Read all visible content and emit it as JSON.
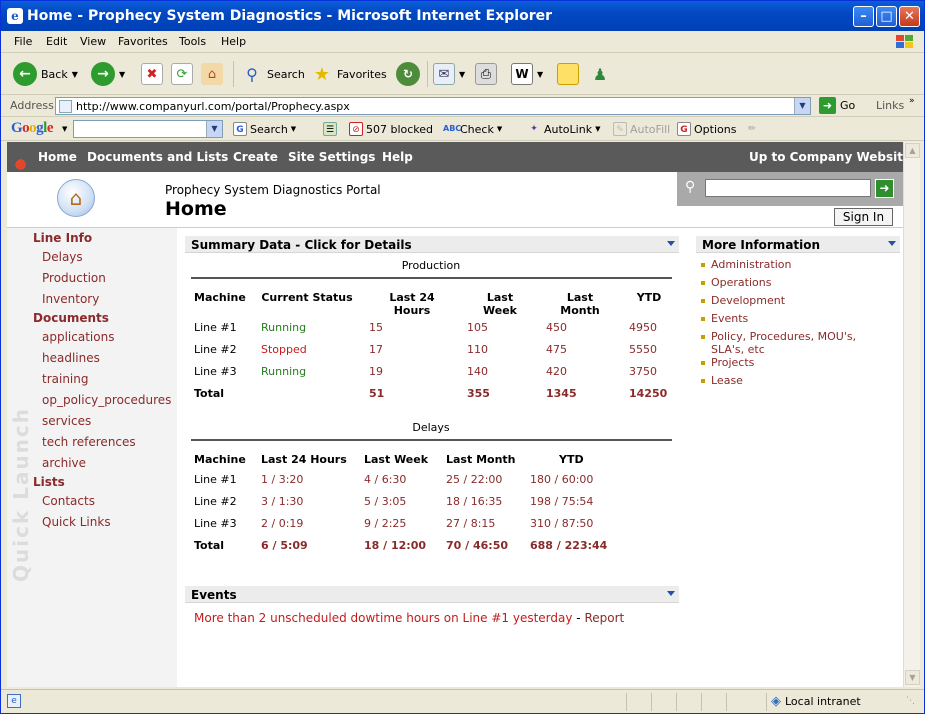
{
  "window": {
    "title": "Home - Prophecy System Diagnostics - Microsoft Internet Explorer"
  },
  "menu": [
    "File",
    "Edit",
    "View",
    "Favorites",
    "Tools",
    "Help"
  ],
  "toolbar": {
    "back": "Back",
    "search": "Search",
    "favorites": "Favorites"
  },
  "address": {
    "label": "Address",
    "url": "http://www.companyurl.com/portal/Prophecy.aspx",
    "go": "Go",
    "links": "Links"
  },
  "google": {
    "logo": "Google",
    "search": "Search",
    "blocked": "507 blocked",
    "check": "Check",
    "autolink": "AutoLink",
    "autofill": "AutoFill",
    "options": "Options"
  },
  "topnav": {
    "items": [
      "Home",
      "Documents and Lists",
      "Create",
      "Site Settings",
      "Help"
    ],
    "right": "Up to Company Website"
  },
  "header": {
    "portal": "Prophecy System Diagnostics Portal",
    "title": "Home",
    "signin": "Sign In"
  },
  "quicklaunch": {
    "vertical": "Quick Launch",
    "line_info": "Line Info",
    "line_items": [
      "Delays",
      "Production",
      "Inventory"
    ],
    "documents": "Documents",
    "doc_items": [
      "applications",
      "headlines",
      "training",
      "op_policy_procedures",
      "services",
      "tech references",
      "archive"
    ],
    "lists": "Lists",
    "list_items": [
      "Contacts",
      "Quick Links"
    ]
  },
  "summary": {
    "header": "Summary Data - Click for Details",
    "production": {
      "title": "Production",
      "cols": [
        "Machine",
        "Current Status",
        "Last 24 Hours",
        "Last Week",
        "Last Month",
        "YTD"
      ],
      "rows": [
        [
          "Line #1",
          "Running",
          "15",
          "105",
          "450",
          "4950"
        ],
        [
          "Line #2",
          "Stopped",
          "17",
          "110",
          "475",
          "5550"
        ],
        [
          "Line #3",
          "Running",
          "19",
          "140",
          "420",
          "3750"
        ]
      ],
      "total": [
        "Total",
        "",
        "51",
        "355",
        "1345",
        "14250"
      ]
    },
    "delays": {
      "title": "Delays",
      "cols": [
        "Machine",
        "Last 24 Hours",
        "Last Week",
        "Last Month",
        "YTD"
      ],
      "rows": [
        [
          "Line #1",
          "1 / 3:20",
          "4 / 6:30",
          "25 / 22:00",
          "180 / 60:00"
        ],
        [
          "Line #2",
          "3 / 1:30",
          "5 / 3:05",
          "18 / 16:35",
          "198 / 75:54"
        ],
        [
          "Line #3",
          "2 / 0:19",
          "9 / 2:25",
          "27 / 8:15",
          "310 / 87:50"
        ]
      ],
      "total": [
        "Total",
        "6 / 5:09",
        "18 / 12:00",
        "70 / 46:50",
        "688 / 223:44"
      ]
    }
  },
  "events": {
    "header": "Events",
    "message": "More than 2 unscheduled dowtime hours on Line #1 yesterday",
    "sep": " - ",
    "link": "Report"
  },
  "more": {
    "header": "More Information",
    "items": [
      "Administration",
      "Operations",
      "Development",
      "Events",
      "Policy, Procedures, MOU's,",
      "SLA's, etc",
      "Projects",
      "Lease"
    ]
  },
  "status": {
    "zone": "Local intranet"
  }
}
